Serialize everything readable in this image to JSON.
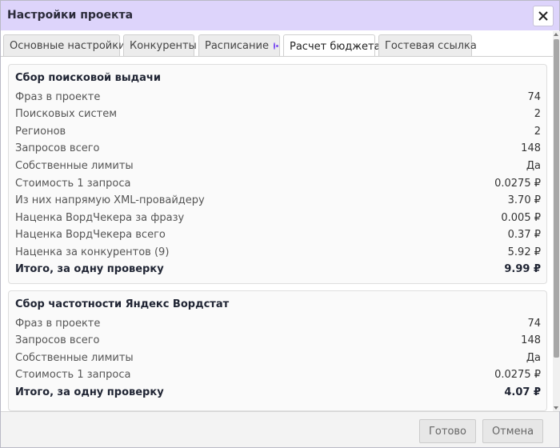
{
  "window": {
    "title": "Настройки проекта"
  },
  "tabs": [
    {
      "label": "Основные настройки"
    },
    {
      "label": "Конкуренты"
    },
    {
      "label": "Расписание"
    },
    {
      "label": "Расчет бюджета"
    },
    {
      "label": "Гостевая ссылка"
    }
  ],
  "active_tab": "Расчет бюджета",
  "panels": [
    {
      "title": "Сбор поисковой выдачи",
      "rows": [
        {
          "label": "Фраз в проекте",
          "value": "74"
        },
        {
          "label": "Поисковых систем",
          "value": "2"
        },
        {
          "label": "Регионов",
          "value": "2"
        },
        {
          "label": "Запросов всего",
          "value": "148"
        },
        {
          "label": "Собственные лимиты",
          "value": "Да"
        },
        {
          "label": "Стоимость 1 запроса",
          "value": "0.0275 ₽"
        },
        {
          "label": "Из них напрямую XML-провайдеру",
          "value": "3.70 ₽"
        },
        {
          "label": "Наценка ВордЧекера за фразу",
          "value": "0.005 ₽"
        },
        {
          "label": "Наценка ВордЧекера всего",
          "value": "0.37 ₽"
        },
        {
          "label": "Наценка за конкурентов (9)",
          "value": "5.92 ₽"
        }
      ],
      "total": {
        "label": "Итого, за одну проверку",
        "value": "9.99 ₽"
      }
    },
    {
      "title": "Сбор частотности Яндекс Вордстат",
      "rows": [
        {
          "label": "Фраз в проекте",
          "value": "74"
        },
        {
          "label": "Запросов всего",
          "value": "148"
        },
        {
          "label": "Собственные лимиты",
          "value": "Да"
        },
        {
          "label": "Стоимость 1 запроса",
          "value": "0.0275 ₽"
        }
      ],
      "total": {
        "label": "Итого, за одну проверку",
        "value": "4.07 ₽"
      }
    }
  ],
  "footer": {
    "done_label": "Готово",
    "cancel_label": "Отмена"
  },
  "icons": {
    "close": "close-icon",
    "tab_indicator": "radio-dot-icon"
  },
  "colors": {
    "titlebar": "#ddd4fb",
    "accent": "#7c4ff0"
  }
}
